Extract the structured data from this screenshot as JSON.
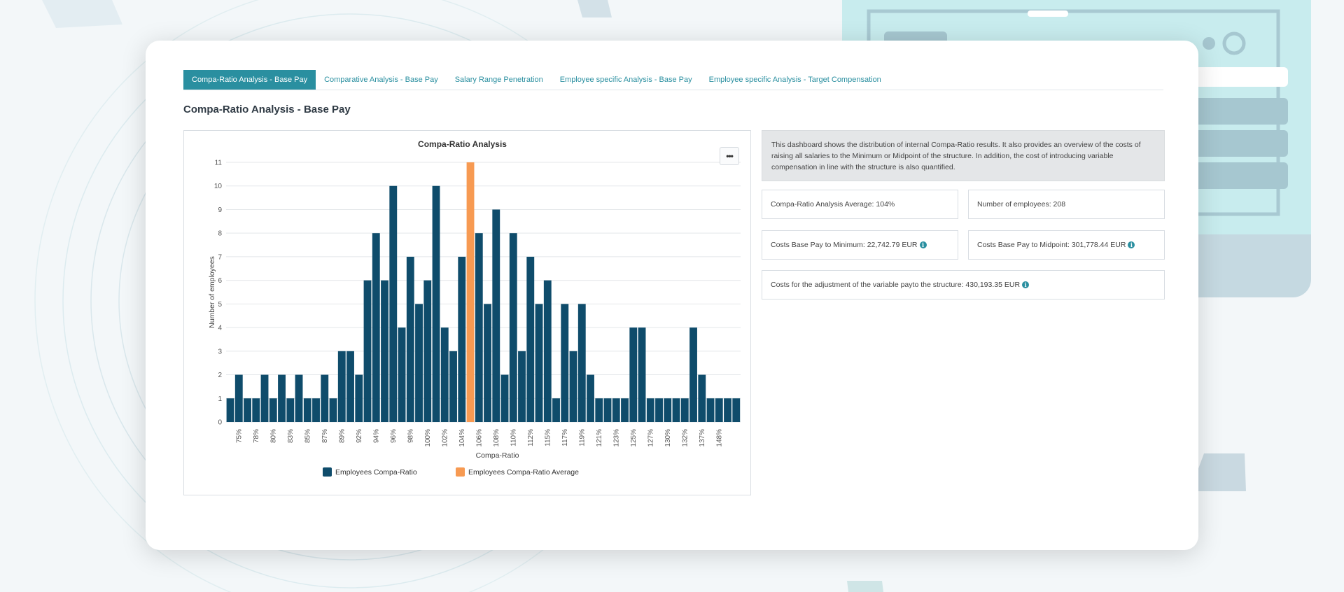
{
  "tabs": [
    {
      "label": "Compa-Ratio Analysis - Base Pay",
      "active": true
    },
    {
      "label": "Comparative Analysis - Base Pay",
      "active": false
    },
    {
      "label": "Salary Range Penetration",
      "active": false
    },
    {
      "label": "Employee specific Analysis - Base Pay",
      "active": false
    },
    {
      "label": "Employee specific Analysis - Target Compensation",
      "active": false
    }
  ],
  "page_title": "Compa-Ratio Analysis - Base Pay",
  "chart_menu_icon": "ellipsis-icon",
  "description": "This dashboard shows the distribution of internal Compa-Ratio results. It also provides an overview of the costs of raising all salaries to the Minimum or Midpoint of the structure. In addition, the cost of introducing variable compensation in line with the structure is also quantified.",
  "stats": {
    "average": "Compa-Ratio Analysis Average: 104%",
    "employees": "Number of employees: 208",
    "cost_minimum": "Costs Base Pay to Minimum: 22,742.79 EUR",
    "cost_midpoint": "Costs Base Pay to Midpoint: 301,778.44 EUR",
    "cost_variable": "Costs for the adjustment of the variable payto the structure: 430,193.35 EUR"
  },
  "info_icon_glyph": "i",
  "colors": {
    "accent": "#2a8fa0",
    "bar": "#0f4c6b",
    "average_bar": "#f79a52"
  },
  "chart_data": {
    "type": "bar",
    "title": "Compa-Ratio Analysis",
    "xlabel": "Compa-Ratio",
    "ylabel": "Number of employees",
    "ylim": [
      0,
      11
    ],
    "yticks": [
      0,
      1,
      2,
      3,
      4,
      5,
      6,
      7,
      8,
      9,
      10,
      11
    ],
    "grid": true,
    "legend_position": "bottom",
    "x_tick_labels": [
      "75%",
      "78%",
      "80%",
      "83%",
      "85%",
      "87%",
      "89%",
      "92%",
      "94%",
      "96%",
      "98%",
      "100%",
      "102%",
      "104%",
      "106%",
      "108%",
      "110%",
      "112%",
      "115%",
      "117%",
      "119%",
      "121%",
      "123%",
      "125%",
      "127%",
      "130%",
      "132%",
      "137%",
      "148%"
    ],
    "values": [
      1,
      2,
      1,
      1,
      2,
      1,
      2,
      1,
      2,
      1,
      1,
      2,
      1,
      3,
      3,
      2,
      6,
      8,
      6,
      10,
      4,
      7,
      5,
      6,
      10,
      4,
      3,
      7,
      11,
      8,
      5,
      9,
      2,
      8,
      3,
      7,
      5,
      6,
      1,
      5,
      3,
      5,
      2,
      1,
      1,
      1,
      1,
      4,
      4,
      1,
      1,
      1,
      1,
      1,
      4,
      2,
      1,
      1,
      1,
      1
    ],
    "highlight_index": 28,
    "series": [
      {
        "name": "Employees Compa-Ratio",
        "color": "#0f4c6b"
      },
      {
        "name": "Employees Compa-Ratio Average",
        "color": "#f79a52"
      }
    ]
  }
}
